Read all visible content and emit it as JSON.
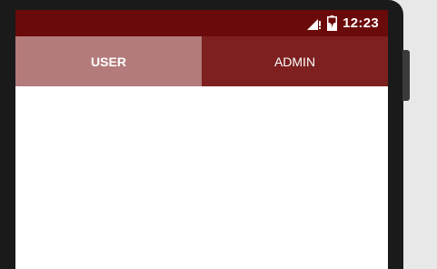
{
  "status_bar": {
    "time": "12:23",
    "signal_icon": "cell-signal-icon",
    "battery_icon": "battery-charging-icon",
    "background_color": "#6b0a0a"
  },
  "tabs": [
    {
      "label": "USER",
      "selected": true
    },
    {
      "label": "ADMIN",
      "selected": false
    }
  ],
  "colors": {
    "tab_active": "#b37b7b",
    "tab_inactive": "#7e2020",
    "content_background": "#ffffff"
  }
}
